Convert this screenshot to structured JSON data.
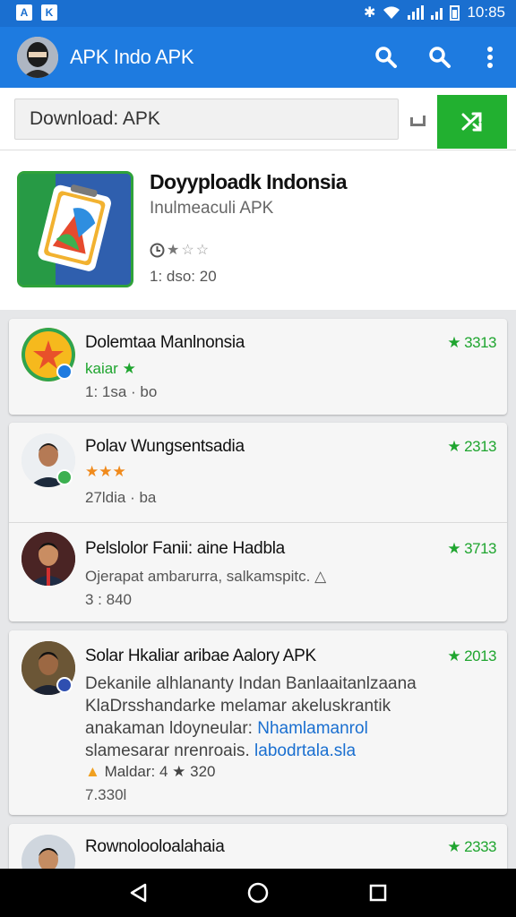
{
  "status_bar": {
    "time": "10:85",
    "notif_icons": [
      "A",
      "K"
    ]
  },
  "app_bar": {
    "title": "APK Indo APK"
  },
  "search": {
    "value": "Download: APK"
  },
  "featured": {
    "title": "Doyyploadk Indonsia",
    "subtitle": "Inulmeaculi APK",
    "rating_stars": 1,
    "meta": "1: dso: 20"
  },
  "items": [
    {
      "title": "Dolemtaa Manlnonsia",
      "score": "3313",
      "line1": "kaiar",
      "line2": "1: 1sa · bo"
    },
    {
      "title": "Polav Wungsentsadia",
      "score": "2313",
      "line2": "27ldia · ba"
    },
    {
      "title": "Pelslolor Fanii: aine Hadbla",
      "score": "3713",
      "line1": "Ojerapat ambarurra, salkamspitc.",
      "line2": "3 : 840"
    },
    {
      "title": "Solar Hkaliar aribae Aalory APK",
      "score": "2013",
      "desc_a": "Dekanile alhlananty Indan Banlaaitanlzaana KlaDrsshandarke melamar akeluskrantik anakaman ldoyneular:",
      "desc_link1": "Nhamlamanrol",
      "desc_b": "slamesarar nrenroais.",
      "desc_link2": "labodrtala.sla",
      "rating_line": "Maldar: 4 ★ 320",
      "line2": "7.330l"
    },
    {
      "title": "Rownolooloalahaia",
      "score": "2333"
    }
  ],
  "colors": {
    "primary": "#1e7be0",
    "accent": "#22b030",
    "score": "#1fa52f"
  }
}
